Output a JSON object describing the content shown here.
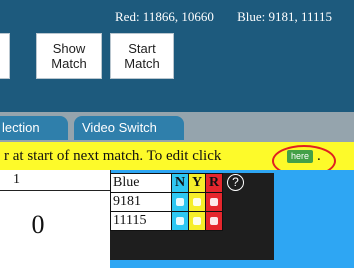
{
  "header": {
    "red_label": "Red: 11866, 10660",
    "blue_label": "Blue: 9181, 11115",
    "show_match": [
      "Show",
      "Match"
    ],
    "start_match": [
      "Start",
      "Match"
    ]
  },
  "tabs": [
    {
      "label": "lection"
    },
    {
      "label": "Video Switch"
    }
  ],
  "notice": {
    "message": "r at start of next match. To edit click",
    "button": "here",
    "tail": "."
  },
  "score": {
    "top_label": "1",
    "value": "0"
  },
  "blue_table": {
    "header": "Blue",
    "columns": [
      "N",
      "Y",
      "R"
    ],
    "help": "?",
    "teams": [
      "9181",
      "11115"
    ]
  },
  "colors": {
    "header_bg": "#1d5a7d",
    "tab_bg": "#2f7fab",
    "notice_bg": "#fdfa2a",
    "here_button": "#43a047",
    "highlight_ring": "#e02020",
    "panel_blue": "#2ea6f3",
    "col_n": "#2ec7f2",
    "col_y": "#f6ee2a",
    "col_r": "#e5262d"
  }
}
